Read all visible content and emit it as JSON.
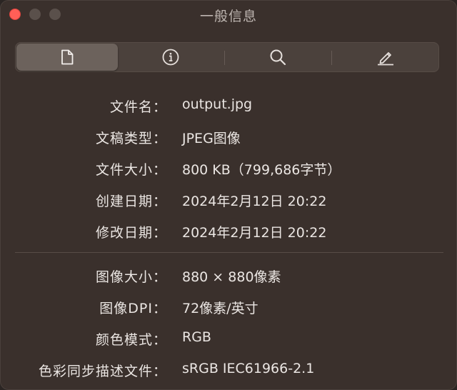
{
  "window": {
    "title": "一般信息"
  },
  "toolbar": {
    "tabs": [
      {
        "icon": "document-icon",
        "selected": true
      },
      {
        "icon": "info-icon",
        "selected": false
      },
      {
        "icon": "search-icon",
        "selected": false
      },
      {
        "icon": "pen-icon",
        "selected": false
      }
    ]
  },
  "file_info": [
    {
      "label": "文件名：",
      "value": "output.jpg"
    },
    {
      "label": "文稿类型：",
      "value": "JPEG图像"
    },
    {
      "label": "文件大小：",
      "value": "800 KB（799,686字节）"
    },
    {
      "label": "创建日期：",
      "value": "2024年2月12日 20:22"
    },
    {
      "label": "修改日期：",
      "value": "2024年2月12日 20:22"
    }
  ],
  "image_info": [
    {
      "label": "图像大小：",
      "value": "880 × 880像素"
    },
    {
      "label": "图像DPI：",
      "value": "72像素/英寸"
    },
    {
      "label": "颜色模式：",
      "value": "RGB"
    },
    {
      "label": "色彩同步描述文件：",
      "value": "sRGB IEC61966-2.1"
    }
  ],
  "colors": {
    "background": "#3a302c",
    "text": "#ebe6e3",
    "close_button": "#ff5f57"
  }
}
